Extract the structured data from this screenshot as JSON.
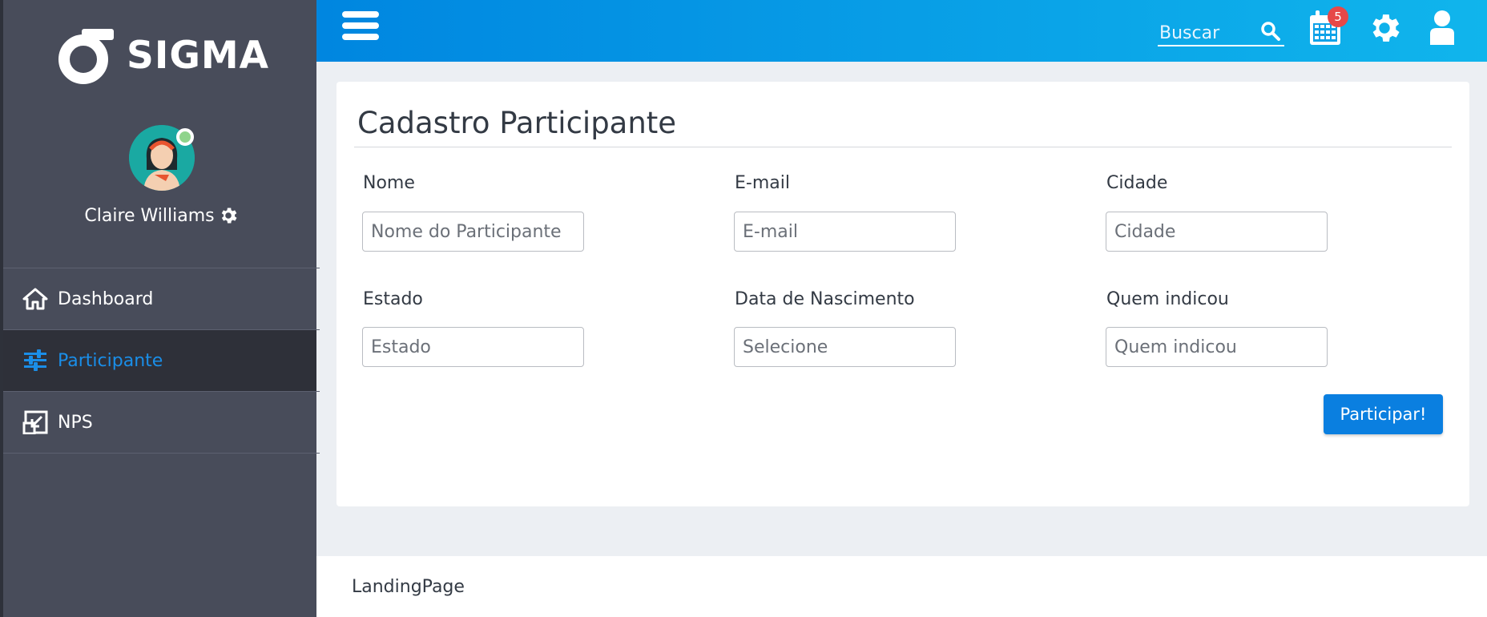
{
  "brand": {
    "name": "SIGMA"
  },
  "user": {
    "name": "Claire Williams",
    "status": "online"
  },
  "sidebar": {
    "items": [
      {
        "label": "Dashboard",
        "icon": "home-icon",
        "active": false
      },
      {
        "label": "Participante",
        "icon": "sliders-icon",
        "active": true
      },
      {
        "label": "NPS",
        "icon": "shrink-icon",
        "active": false
      }
    ]
  },
  "topbar": {
    "search_placeholder": "Buscar",
    "calendar_badge": "5"
  },
  "form": {
    "title": "Cadastro Participante",
    "fields": [
      {
        "label": "Nome",
        "placeholder": "Nome do Participante"
      },
      {
        "label": "E-mail",
        "placeholder": "E-mail"
      },
      {
        "label": "Cidade",
        "placeholder": "Cidade"
      },
      {
        "label": "Estado",
        "placeholder": "Estado"
      },
      {
        "label": "Data de Nascimento",
        "placeholder": "Selecione"
      },
      {
        "label": "Quem indicou",
        "placeholder": "Quem indicou"
      }
    ],
    "submit_label": "Participar!"
  },
  "footer": {
    "text": "LandingPage"
  },
  "colors": {
    "sidebar_bg": "#484c5a",
    "sidebar_active_bg": "#2e3039",
    "accent": "#1a8ee8",
    "topbar_start": "#0086e0",
    "topbar_end": "#10b5ec",
    "button": "#0a7fe0",
    "badge": "#e64848"
  }
}
